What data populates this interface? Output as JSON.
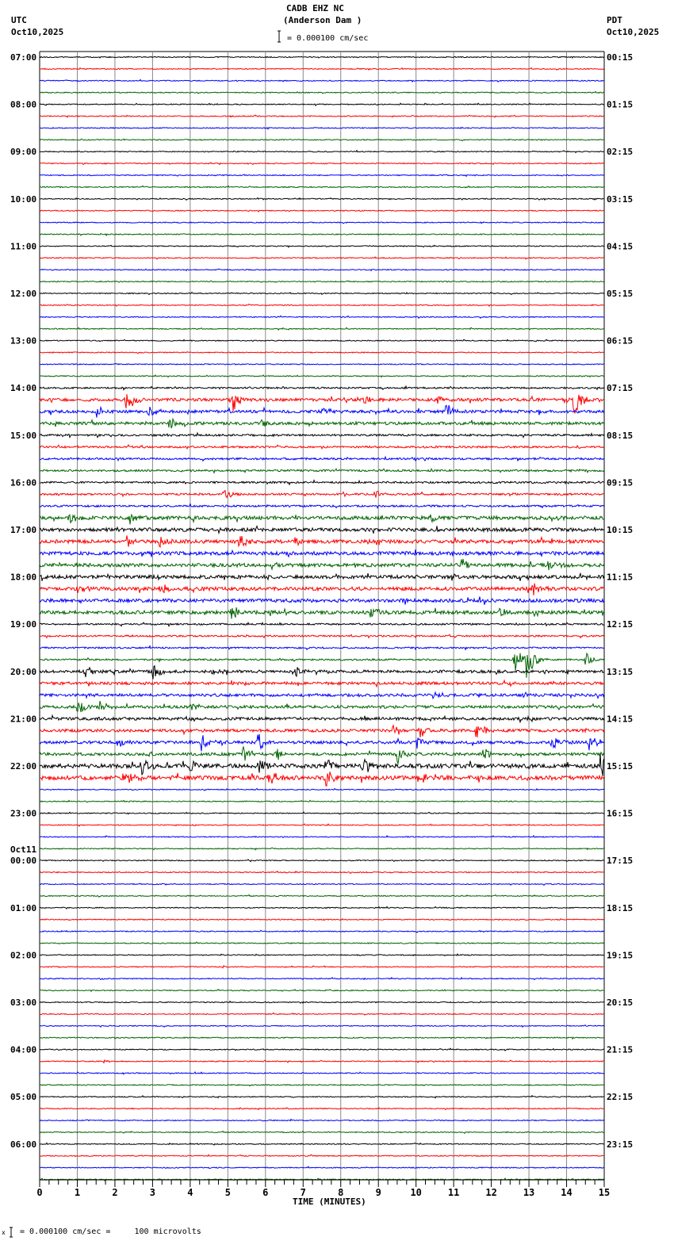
{
  "header": {
    "title": "CADB EHZ NC",
    "subtitle": "(Anderson Dam )",
    "scale_text": "= 0.000100 cm/sec",
    "left_tz": "UTC",
    "left_date": "Oct10,2025",
    "right_tz": "PDT",
    "right_date": "Oct10,2025"
  },
  "footer": {
    "scale_text": "= 0.000100 cm/sec =     100 microvolts",
    "mark": "x"
  },
  "chart_data": {
    "type": "line",
    "title": "CADB EHZ NC (Anderson Dam )",
    "xlabel": "TIME (MINUTES)",
    "xlim": [
      0,
      15
    ],
    "x_ticks": [
      "0",
      "1",
      "2",
      "3",
      "4",
      "5",
      "6",
      "7",
      "8",
      "9",
      "10",
      "11",
      "12",
      "13",
      "14",
      "15"
    ],
    "traces_per_hour": 4,
    "trace_colors": [
      "#000000",
      "#ff0000",
      "#0000ff",
      "#006400"
    ],
    "left_labels": [
      "07:00",
      "08:00",
      "09:00",
      "10:00",
      "11:00",
      "12:00",
      "13:00",
      "14:00",
      "15:00",
      "16:00",
      "17:00",
      "18:00",
      "19:00",
      "20:00",
      "21:00",
      "22:00",
      "23:00",
      "00:00",
      "01:00",
      "02:00",
      "03:00",
      "04:00",
      "05:00",
      "06:00"
    ],
    "date_change_label": "Oct11",
    "date_change_index": 17,
    "right_labels": [
      "00:15",
      "01:15",
      "02:15",
      "03:15",
      "04:15",
      "05:15",
      "06:15",
      "07:15",
      "08:15",
      "09:15",
      "10:15",
      "11:15",
      "12:15",
      "13:15",
      "14:15",
      "15:15",
      "16:15",
      "17:15",
      "18:15",
      "19:15",
      "20:15",
      "21:15",
      "22:15",
      "23:15"
    ],
    "noise_levels": [
      {
        "from": 0,
        "to": 27,
        "level": 0.6
      },
      {
        "from": 28,
        "to": 28,
        "level": 1.0
      },
      {
        "from": 29,
        "to": 31,
        "level": 1.8
      },
      {
        "from": 32,
        "to": 38,
        "level": 1.2
      },
      {
        "from": 39,
        "to": 47,
        "level": 2.2
      },
      {
        "from": 48,
        "to": 51,
        "level": 1.0
      },
      {
        "from": 52,
        "to": 59,
        "level": 1.8
      },
      {
        "from": 60,
        "to": 61,
        "level": 2.6
      },
      {
        "from": 62,
        "to": 95,
        "level": 0.6
      }
    ],
    "events": [
      {
        "trace": 29,
        "minute": 2.3,
        "amp": 18
      },
      {
        "trace": 29,
        "minute": 5.1,
        "amp": 22
      },
      {
        "trace": 29,
        "minute": 14.2,
        "amp": 28
      },
      {
        "trace": 29,
        "minute": 8.6,
        "amp": 6
      },
      {
        "trace": 29,
        "minute": 10.5,
        "amp": 6
      },
      {
        "trace": 30,
        "minute": 1.5,
        "amp": 8
      },
      {
        "trace": 30,
        "minute": 2.9,
        "amp": 8
      },
      {
        "trace": 30,
        "minute": 10.8,
        "amp": 10
      },
      {
        "trace": 30,
        "minute": 7.5,
        "amp": 6
      },
      {
        "trace": 31,
        "minute": 3.4,
        "amp": 10
      },
      {
        "trace": 31,
        "minute": 5.9,
        "amp": 6
      },
      {
        "trace": 37,
        "minute": 4.9,
        "amp": 8
      },
      {
        "trace": 37,
        "minute": 8.9,
        "amp": 5
      },
      {
        "trace": 39,
        "minute": 0.8,
        "amp": 7
      },
      {
        "trace": 39,
        "minute": 2.4,
        "amp": 8
      },
      {
        "trace": 39,
        "minute": 10.4,
        "amp": 6
      },
      {
        "trace": 39,
        "minute": 13.6,
        "amp": 6
      },
      {
        "trace": 40,
        "minute": 14.7,
        "amp": 7
      },
      {
        "trace": 41,
        "minute": 2.3,
        "amp": 8
      },
      {
        "trace": 41,
        "minute": 3.2,
        "amp": 10
      },
      {
        "trace": 41,
        "minute": 5.3,
        "amp": 9
      },
      {
        "trace": 41,
        "minute": 6.8,
        "amp": 7
      },
      {
        "trace": 43,
        "minute": 11.2,
        "amp": 10
      },
      {
        "trace": 43,
        "minute": 13.5,
        "amp": 9
      },
      {
        "trace": 45,
        "minute": 1.0,
        "amp": 7
      },
      {
        "trace": 45,
        "minute": 3.2,
        "amp": 7
      },
      {
        "trace": 45,
        "minute": 13.1,
        "amp": 10
      },
      {
        "trace": 47,
        "minute": 5.1,
        "amp": 10
      },
      {
        "trace": 47,
        "minute": 8.8,
        "amp": 8
      },
      {
        "trace": 47,
        "minute": 12.2,
        "amp": 6
      },
      {
        "trace": 51,
        "minute": 12.6,
        "amp": 20
      },
      {
        "trace": 51,
        "minute": 12.95,
        "amp": 30
      },
      {
        "trace": 51,
        "minute": 14.5,
        "amp": 10
      },
      {
        "trace": 52,
        "minute": 1.2,
        "amp": 12
      },
      {
        "trace": 52,
        "minute": 3.0,
        "amp": 12
      },
      {
        "trace": 52,
        "minute": 4.6,
        "amp": 7
      },
      {
        "trace": 52,
        "minute": 6.8,
        "amp": 9
      },
      {
        "trace": 54,
        "minute": 10.4,
        "amp": 8
      },
      {
        "trace": 55,
        "minute": 1.0,
        "amp": 12
      },
      {
        "trace": 55,
        "minute": 1.6,
        "amp": 7
      },
      {
        "trace": 55,
        "minute": 4.0,
        "amp": 8
      },
      {
        "trace": 57,
        "minute": 9.4,
        "amp": 9
      },
      {
        "trace": 57,
        "minute": 10.1,
        "amp": 10
      },
      {
        "trace": 57,
        "minute": 11.6,
        "amp": 14
      },
      {
        "trace": 58,
        "minute": 2.1,
        "amp": 9
      },
      {
        "trace": 58,
        "minute": 4.3,
        "amp": 14
      },
      {
        "trace": 58,
        "minute": 5.8,
        "amp": 12
      },
      {
        "trace": 58,
        "minute": 10.0,
        "amp": 10
      },
      {
        "trace": 58,
        "minute": 13.6,
        "amp": 12
      },
      {
        "trace": 58,
        "minute": 14.6,
        "amp": 14
      },
      {
        "trace": 59,
        "minute": 5.4,
        "amp": 12
      },
      {
        "trace": 59,
        "minute": 6.3,
        "amp": 10
      },
      {
        "trace": 59,
        "minute": 9.5,
        "amp": 14
      },
      {
        "trace": 59,
        "minute": 11.8,
        "amp": 9
      },
      {
        "trace": 60,
        "minute": 2.7,
        "amp": 14
      },
      {
        "trace": 60,
        "minute": 4.0,
        "amp": 10
      },
      {
        "trace": 60,
        "minute": 5.8,
        "amp": 12
      },
      {
        "trace": 60,
        "minute": 7.6,
        "amp": 14
      },
      {
        "trace": 60,
        "minute": 8.6,
        "amp": 16
      },
      {
        "trace": 60,
        "minute": 14.9,
        "amp": 18
      },
      {
        "trace": 61,
        "minute": 2.2,
        "amp": 12
      },
      {
        "trace": 61,
        "minute": 6.1,
        "amp": 12
      },
      {
        "trace": 61,
        "minute": 7.6,
        "amp": 14
      },
      {
        "trace": 61,
        "minute": 10.2,
        "amp": 7
      },
      {
        "trace": 85,
        "minute": 1.7,
        "amp": 3
      }
    ]
  }
}
